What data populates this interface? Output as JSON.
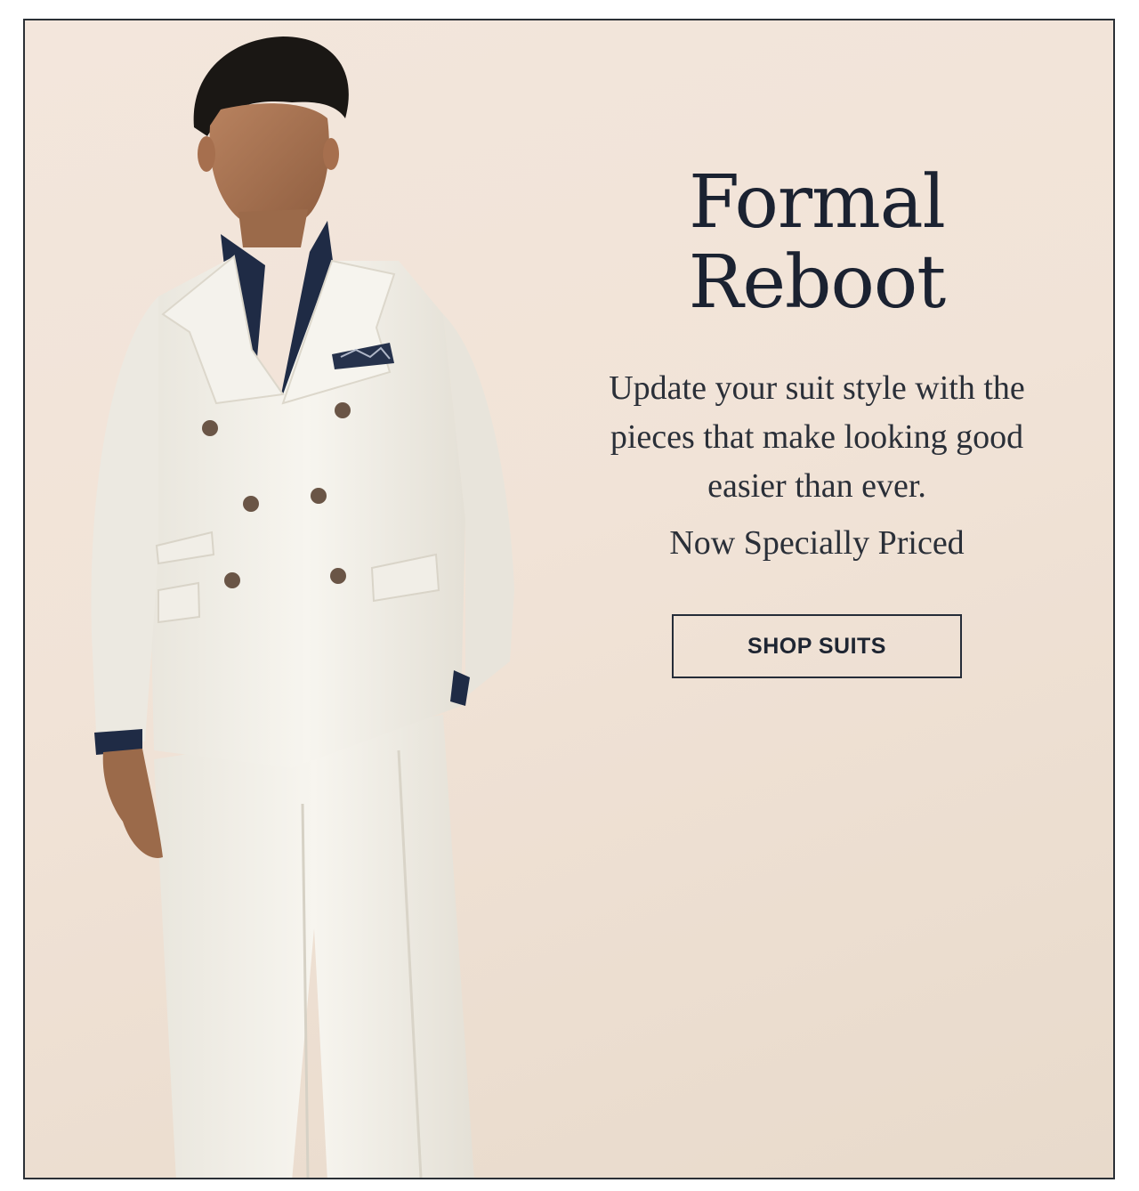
{
  "banner": {
    "headline": "Formal Reboot",
    "body": "Update your suit style with the pieces that make looking good easier than ever.",
    "pricing": "Now Specially Priced",
    "cta_label": "SHOP SUITS",
    "hero_image_icon": "model-in-white-double-breasted-suit-image",
    "colors": {
      "background": "#f1e3d7",
      "text": "#1b2231",
      "border": "#2b3036"
    }
  }
}
